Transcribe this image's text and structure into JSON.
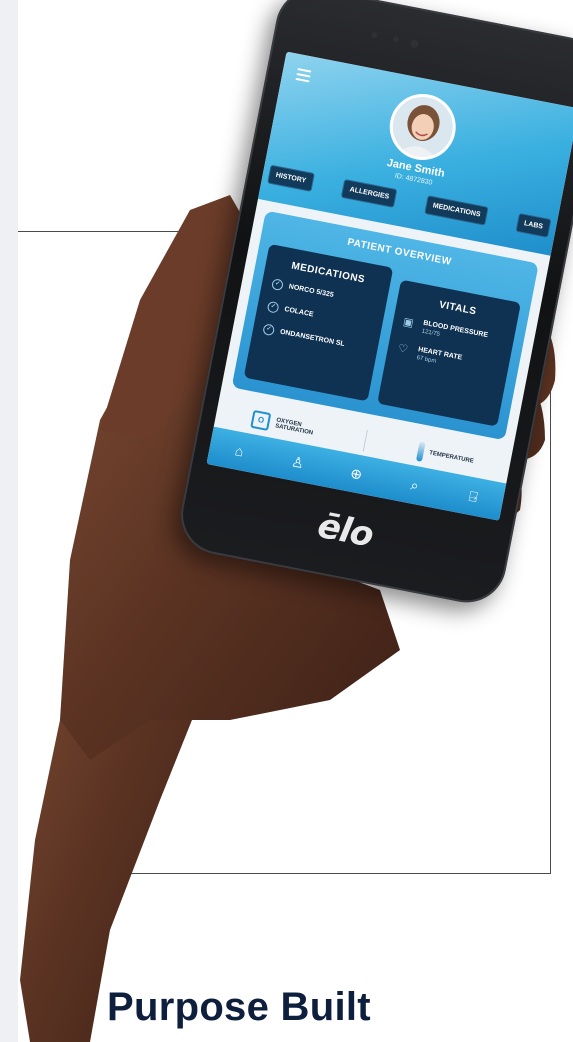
{
  "app": {
    "patient_name": "Jane Smith",
    "patient_id": "ID: 4872830",
    "tabs": [
      "HISTORY",
      "ALLERGIES",
      "MEDICATIONS",
      "LABS"
    ],
    "overview_title": "PATIENT OVERVIEW",
    "medications": {
      "title": "MEDICATIONS",
      "items": [
        "NORCO 5/325",
        "COLACE",
        "ONDANSETRON SL"
      ]
    },
    "vitals": {
      "title": "VITALS",
      "blood_pressure_label": "BLOOD PRESSURE",
      "blood_pressure_value": "121/75",
      "heart_rate_label": "HEART RATE",
      "heart_rate_value": "67 bpm"
    },
    "oxygen_label_1": "OXYGEN",
    "oxygen_label_2": "SATURATION",
    "temperature_label": "TEMPERATURE",
    "nav_icons": [
      "home-icon",
      "user-icon",
      "plus-circle-icon",
      "search-icon",
      "exit-icon"
    ]
  },
  "device_brand": "ēlo",
  "headline": "Purpose Built",
  "colors": {
    "accent": "#2a9ad6",
    "card": "#0f3252",
    "headline": "#0e1f3d"
  }
}
